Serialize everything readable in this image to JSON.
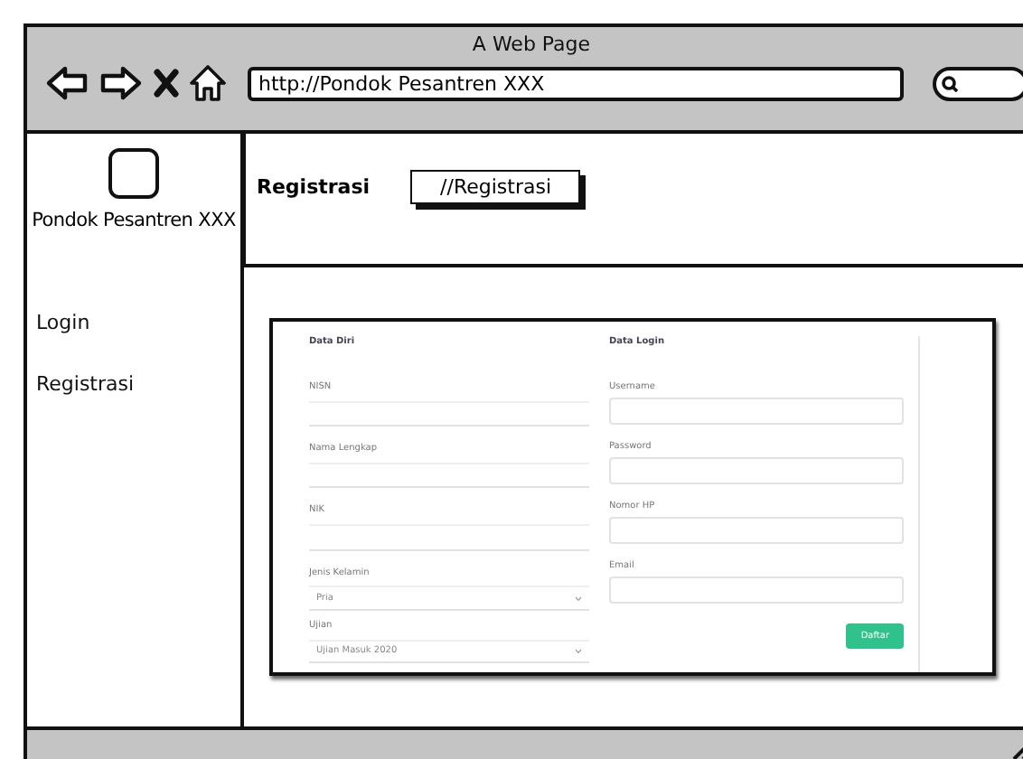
{
  "window": {
    "title": "A Web Page",
    "address": "http://Pondok Pesantren XXX"
  },
  "sidebar": {
    "brand": "Pondok Pesantren XXX",
    "items": [
      {
        "label": "Login"
      },
      {
        "label": "Registrasi"
      }
    ]
  },
  "header": {
    "title": "Registrasi",
    "breadcrumb": "//Registrasi"
  },
  "form": {
    "sections": [
      {
        "title": "Data Diri",
        "fields": [
          {
            "label": "NISN",
            "kind": "text"
          },
          {
            "label": "Nama Lengkap",
            "kind": "text"
          },
          {
            "label": "NIK",
            "kind": "text"
          },
          {
            "label": "Jenis Kelamin",
            "kind": "select",
            "value": "Pria"
          },
          {
            "label": "Ujian",
            "kind": "select",
            "value": "Ujian Masuk 2020"
          }
        ]
      },
      {
        "title": "Data Login",
        "fields": [
          {
            "label": "Username",
            "kind": "text"
          },
          {
            "label": "Password",
            "kind": "text"
          },
          {
            "label": "Nomor HP",
            "kind": "text"
          },
          {
            "label": "Email",
            "kind": "text"
          }
        ]
      }
    ],
    "submit": "Daftar"
  }
}
